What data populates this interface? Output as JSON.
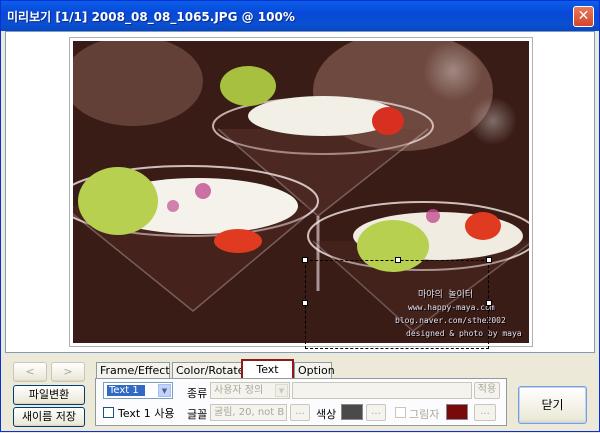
{
  "window": {
    "title": "미리보기 [1/1] 2008_08_08_1065.JPG @ 100%"
  },
  "photo": {
    "watermark": {
      "line1": "마야의 놀이터",
      "line2": "www.happy-maya.com",
      "line3": "blog.naver.com/sthe2002",
      "line4": "designed & photo by maya"
    }
  },
  "nav": {
    "prev_label": "<",
    "next_label": ">"
  },
  "buttons": {
    "convert_label": "파일변환",
    "save_as_label": "새이름 저장",
    "close_label": "닫기"
  },
  "tabs": [
    {
      "label": "Frame/Effect"
    },
    {
      "label": "Color/Rotate"
    },
    {
      "label": "Text"
    },
    {
      "label": "Option"
    }
  ],
  "text_panel": {
    "text_select_value": "Text 1",
    "use_label": "Text 1 사용",
    "type_label": "종류",
    "type_value": "사용자 정의",
    "apply_label": "적용",
    "font_label": "글꼴",
    "font_value": "굴림, 20, not B",
    "font_button_label": "...",
    "color_label": "색상",
    "color_button_label": "...",
    "shadow_label": "그림자",
    "shadow_button_label": "...",
    "text_color": "#4a4a4a",
    "shadow_color": "#7a0a0a"
  },
  "colors": {
    "titlebar": "#0a4fd0",
    "active_tab_border": "#8b1a1a"
  }
}
